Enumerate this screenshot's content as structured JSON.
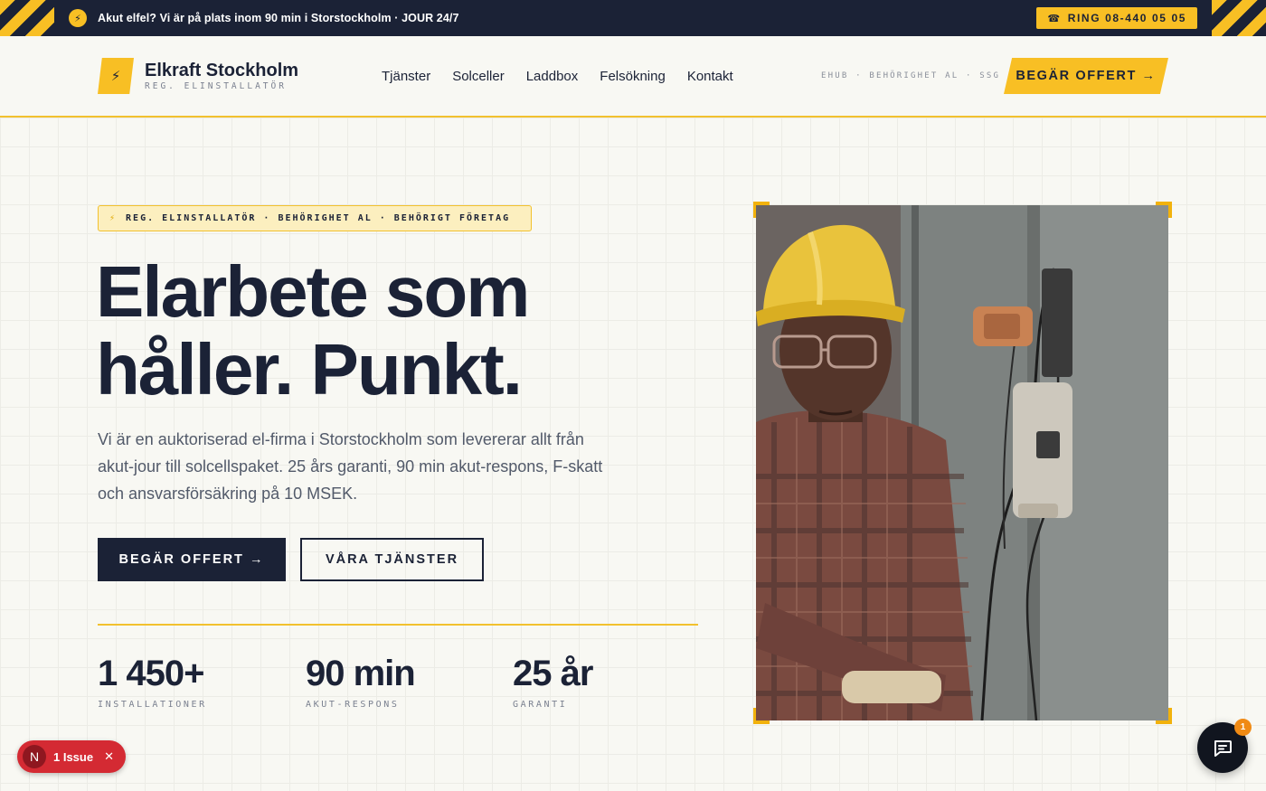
{
  "alert": {
    "text": "Akut elfel? Vi är på plats inom 90 min i Storstockholm · JOUR 24/7",
    "phone_button": "RING 08-440 05 05"
  },
  "header": {
    "brand_name": "Elkraft Stockholm",
    "brand_sub": "REG. ELINSTALLATÖR",
    "nav": [
      "Tjänster",
      "Solceller",
      "Laddbox",
      "Felsökning",
      "Kontakt"
    ],
    "badges": "EHUB · BEHÖRIGHET AL · SSG",
    "offer_button": "BEGÄR OFFERT →"
  },
  "hero": {
    "tag": "REG. ELINSTALLATÖR · BEHÖRIGHET AL · BEHÖRIGT FÖRETAG",
    "title_line1": "Elarbete som",
    "title_line2": "håller. Punkt.",
    "description": "Vi är en auktoriserad el-firma i Storstockholm som levererar allt från akut-jour till solcellspaket. 25 års garanti, 90 min akut-respons, F-skatt och ansvarsförsäkring på 10 MSEK.",
    "primary_button": "BEGÄR OFFERT →",
    "secondary_button": "VÅRA TJÄNSTER",
    "stats": [
      {
        "value": "1 450+",
        "label": "INSTALLATIONER"
      },
      {
        "value": "90 min",
        "label": "AKUT-RESPONS"
      },
      {
        "value": "25 år",
        "label": "GARANTI"
      }
    ]
  },
  "widgets": {
    "issue_avatar": "N",
    "issue_text": "1 Issue",
    "chat_badge": "1"
  },
  "colors": {
    "navy": "#1b2236",
    "accent_yellow": "#f8bf24",
    "background": "#f8f8f3",
    "issue_red": "#d42a33"
  },
  "icons": [
    "bolt-icon",
    "phone-icon",
    "close-icon",
    "chat-icon"
  ]
}
